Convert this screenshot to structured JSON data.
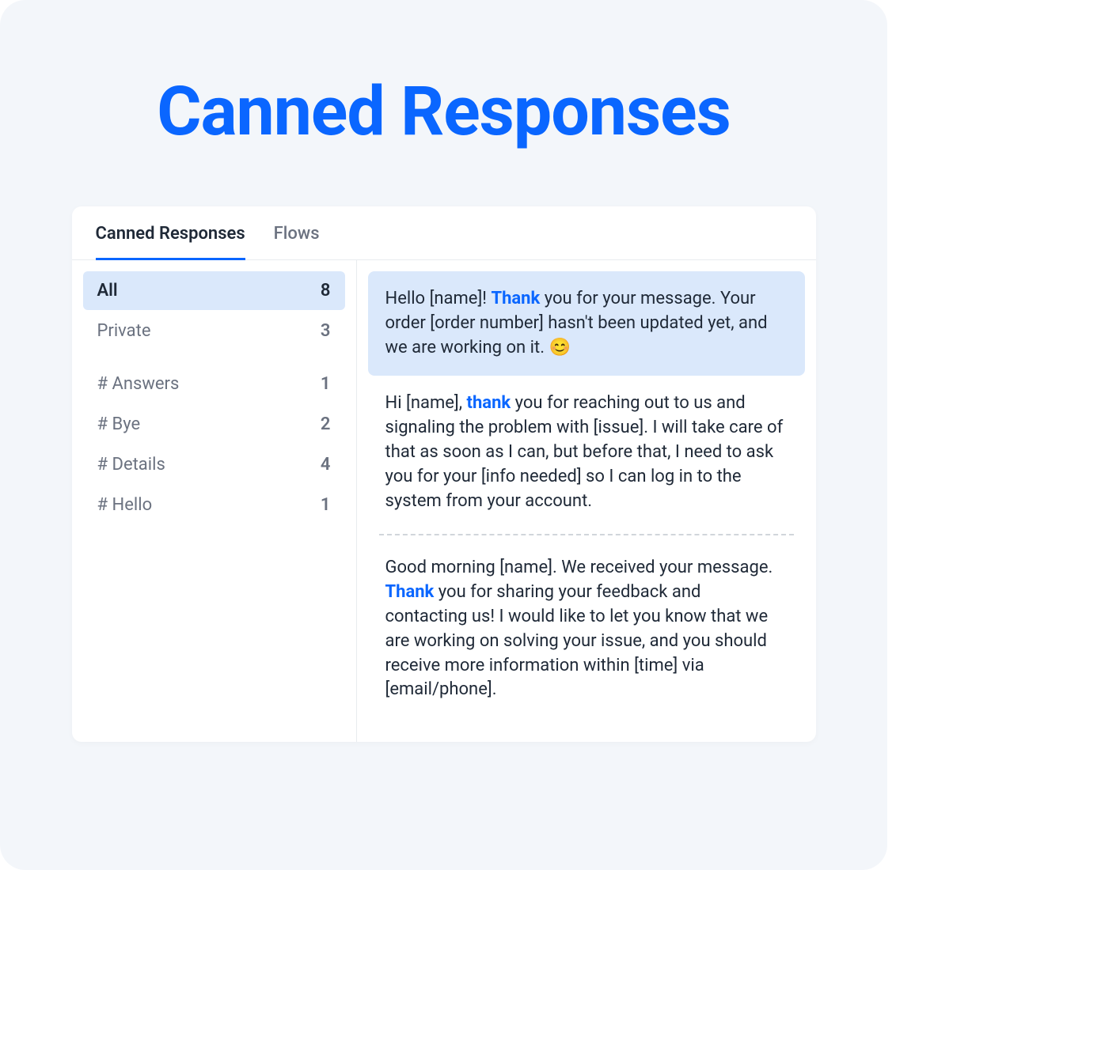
{
  "title": "Canned Responses",
  "tabs": [
    {
      "label": "Canned Responses",
      "active": true
    },
    {
      "label": "Flows",
      "active": false
    }
  ],
  "sidebar": {
    "primary": [
      {
        "label": "All",
        "count": "8",
        "active": true
      },
      {
        "label": "Private",
        "count": "3",
        "active": false
      }
    ],
    "tags": [
      {
        "label": "# Answers",
        "count": "1"
      },
      {
        "label": "# Bye",
        "count": "2"
      },
      {
        "label": "# Details",
        "count": "4"
      },
      {
        "label": "# Hello",
        "count": "1"
      }
    ]
  },
  "responses": [
    {
      "selected": true,
      "pre": "Hello [name]! ",
      "highlight": "Thank",
      "post": " you for your message. Your order [order number] hasn't been updated yet, and we are working on it. 😊"
    },
    {
      "selected": false,
      "pre": "Hi [name], ",
      "highlight": "thank",
      "post": " you for reaching out to us and signaling the problem with [issue]. I will take care of that as soon as I can, but before that, I need to ask you for your [info needed] so I can log in to the system from your account."
    },
    {
      "selected": false,
      "pre": "Good morning [name]. We received your message. ",
      "highlight": "Thank",
      "post": " you for sharing your feedback and contacting us! I would like to let you know that we are working on solving your issue, and you should receive more information within [time] via [email/phone]."
    }
  ]
}
